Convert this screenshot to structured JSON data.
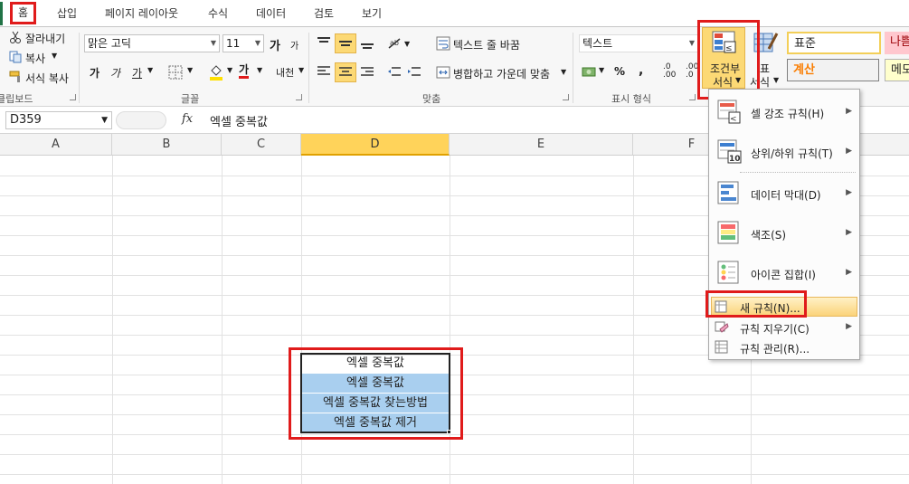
{
  "tabs": [
    "홈",
    "삽입",
    "페이지 레이아웃",
    "수식",
    "데이터",
    "검토",
    "보기"
  ],
  "clipboard": {
    "cut": "잘라내기",
    "copy": "복사",
    "format_painter": "서식 복사",
    "group_label": "클립보드"
  },
  "font": {
    "name": "맑은 고딕",
    "size": "11",
    "grow": "가",
    "shrink": "가",
    "bold": "가",
    "italic": "가",
    "underline": "가",
    "color_char": "가",
    "phonetic": "내천",
    "group_label": "글꼴"
  },
  "alignment": {
    "wrap_text": "텍스트 줄 바꿈",
    "merge_center": "병합하고 가운데 맞춤",
    "group_label": "맞춤"
  },
  "number": {
    "format": "텍스트",
    "percent": "%",
    "comma": ",",
    "inc_decimal": ".0 .00",
    "dec_decimal": ".00 .0",
    "group_label": "표시 형식"
  },
  "styles": {
    "conditional_formatting": [
      "조건부",
      "서식"
    ],
    "format_as_table": [
      "표",
      "서식"
    ],
    "normal": "표준",
    "bad": "나쁨",
    "calculation": "계산",
    "note": "메모"
  },
  "formula_bar": {
    "name_box": "D359",
    "fx": "fx",
    "content": "엑셀 중복값"
  },
  "columns": [
    "A",
    "B",
    "C",
    "D",
    "E",
    "F"
  ],
  "selected_column": "D",
  "cells": [
    "엑셀 중복값",
    "엑셀 중복값",
    "엑셀 중복값 찾는방법",
    "엑셀 중복값 제거"
  ],
  "menu": {
    "items": [
      {
        "label": "셀 강조 규칙(H)"
      },
      {
        "label": "상위/하위 규칙(T)"
      },
      {
        "label": "데이터 막대(D)"
      },
      {
        "label": "색조(S)"
      },
      {
        "label": "아이콘 집합(I)"
      },
      {
        "label": "새 규칙(N)..."
      },
      {
        "label": "규칙 지우기(C)"
      },
      {
        "label": "규칙 관리(R)..."
      }
    ]
  },
  "colors": {
    "accent_red": "#e01b1b",
    "selection_blue": "#a9cfef",
    "column_highlight": "#ffd35a",
    "excel_green": "#217346"
  }
}
